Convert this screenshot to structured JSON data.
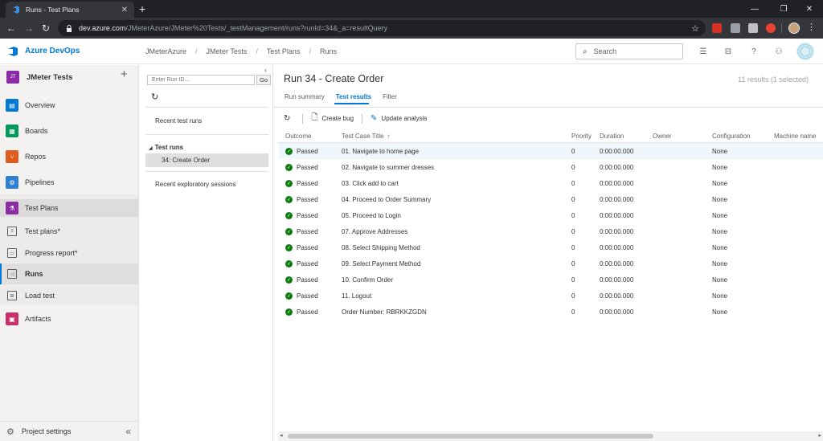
{
  "browser": {
    "tab_title": "Runs - Test Plans",
    "url_host": "dev.azure.com",
    "url_path": "/JMeterAzure/JMeter%20Tests/_testManagement/runs?runId=34&_a=resultQuery"
  },
  "header": {
    "brand": "Azure DevOps",
    "breadcrumb": [
      "JMeterAzure",
      "JMeter Tests",
      "Test Plans",
      "Runs"
    ],
    "search_placeholder": "Search"
  },
  "project": {
    "initials": "JT",
    "name": "JMeter Tests"
  },
  "nav": {
    "overview": "Overview",
    "boards": "Boards",
    "repos": "Repos",
    "pipelines": "Pipelines",
    "test_plans": "Test Plans",
    "test_plans_sub": "Test plans*",
    "progress_report": "Progress report*",
    "runs": "Runs",
    "load_test": "Load test",
    "artifacts": "Artifacts",
    "project_settings": "Project settings"
  },
  "runs_pane": {
    "run_id_placeholder": "Enter Run ID...",
    "go_label": "Go",
    "recent_test_runs": "Recent test runs",
    "test_runs_group": "Test runs",
    "selected_run": "34: Create Order",
    "recent_exploratory": "Recent exploratory sessions"
  },
  "main": {
    "title": "Run 34 - Create Order",
    "results_count": "11 results (1 selected)",
    "tabs": [
      "Run summary",
      "Test results",
      "Filter"
    ],
    "create_bug": "Create bug",
    "update_analysis": "Update analysis",
    "columns": {
      "outcome": "Outcome",
      "title": "Test Case Title",
      "priority": "Priority",
      "duration": "Duration",
      "owner": "Owner",
      "configuration": "Configuration",
      "machine": "Machine name"
    },
    "rows": [
      {
        "outcome": "Passed",
        "title": "01. Navigate to home page",
        "priority": "0",
        "duration": "0:00:00.000",
        "owner": "",
        "config": "None",
        "machine": ""
      },
      {
        "outcome": "Passed",
        "title": "02. Navigate to summer dresses",
        "priority": "0",
        "duration": "0:00:00.000",
        "owner": "",
        "config": "None",
        "machine": ""
      },
      {
        "outcome": "Passed",
        "title": "03. Click add to cart",
        "priority": "0",
        "duration": "0:00:00.000",
        "owner": "",
        "config": "None",
        "machine": ""
      },
      {
        "outcome": "Passed",
        "title": "04. Proceed to Order Summary",
        "priority": "0",
        "duration": "0:00:00.000",
        "owner": "",
        "config": "None",
        "machine": ""
      },
      {
        "outcome": "Passed",
        "title": "05. Proceed to Login",
        "priority": "0",
        "duration": "0:00:00.000",
        "owner": "",
        "config": "None",
        "machine": ""
      },
      {
        "outcome": "Passed",
        "title": "07. Approve Addresses",
        "priority": "0",
        "duration": "0:00:00.000",
        "owner": "",
        "config": "None",
        "machine": ""
      },
      {
        "outcome": "Passed",
        "title": "08. Select Shipping Method",
        "priority": "0",
        "duration": "0:00:00.000",
        "owner": "",
        "config": "None",
        "machine": ""
      },
      {
        "outcome": "Passed",
        "title": "09. Select Payment Method",
        "priority": "0",
        "duration": "0:00:00.000",
        "owner": "",
        "config": "None",
        "machine": ""
      },
      {
        "outcome": "Passed",
        "title": "10. Confirm Order",
        "priority": "0",
        "duration": "0:00:00.000",
        "owner": "",
        "config": "None",
        "machine": ""
      },
      {
        "outcome": "Passed",
        "title": "11. Logout",
        "priority": "0",
        "duration": "0:00:00.000",
        "owner": "",
        "config": "None",
        "machine": ""
      },
      {
        "outcome": "Passed",
        "title": "Order Number: RBRKKZGDN",
        "priority": "0",
        "duration": "0:00:00.000",
        "owner": "",
        "config": "None",
        "machine": ""
      }
    ]
  },
  "colors": {
    "accent": "#0078d4",
    "passed": "#107c10",
    "test_plans_purple": "#8a2da5"
  }
}
